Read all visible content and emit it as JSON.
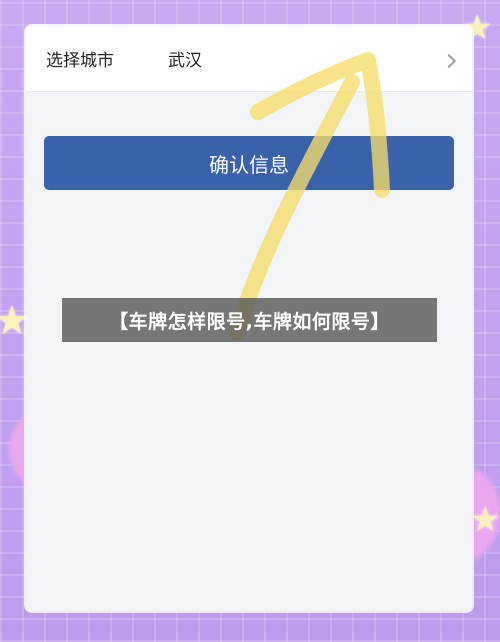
{
  "city_selector": {
    "label": "选择城市",
    "value": "武汉"
  },
  "confirm_button": {
    "label": "确认信息"
  },
  "banner": {
    "text": "【车牌怎样限号,车牌如何限号】"
  },
  "colors": {
    "button": "#3a62aa",
    "screen_bg": "#f2f4f7",
    "arrow": "#f5dd6a"
  },
  "icons": {
    "chevron": "chevron-right-icon"
  }
}
